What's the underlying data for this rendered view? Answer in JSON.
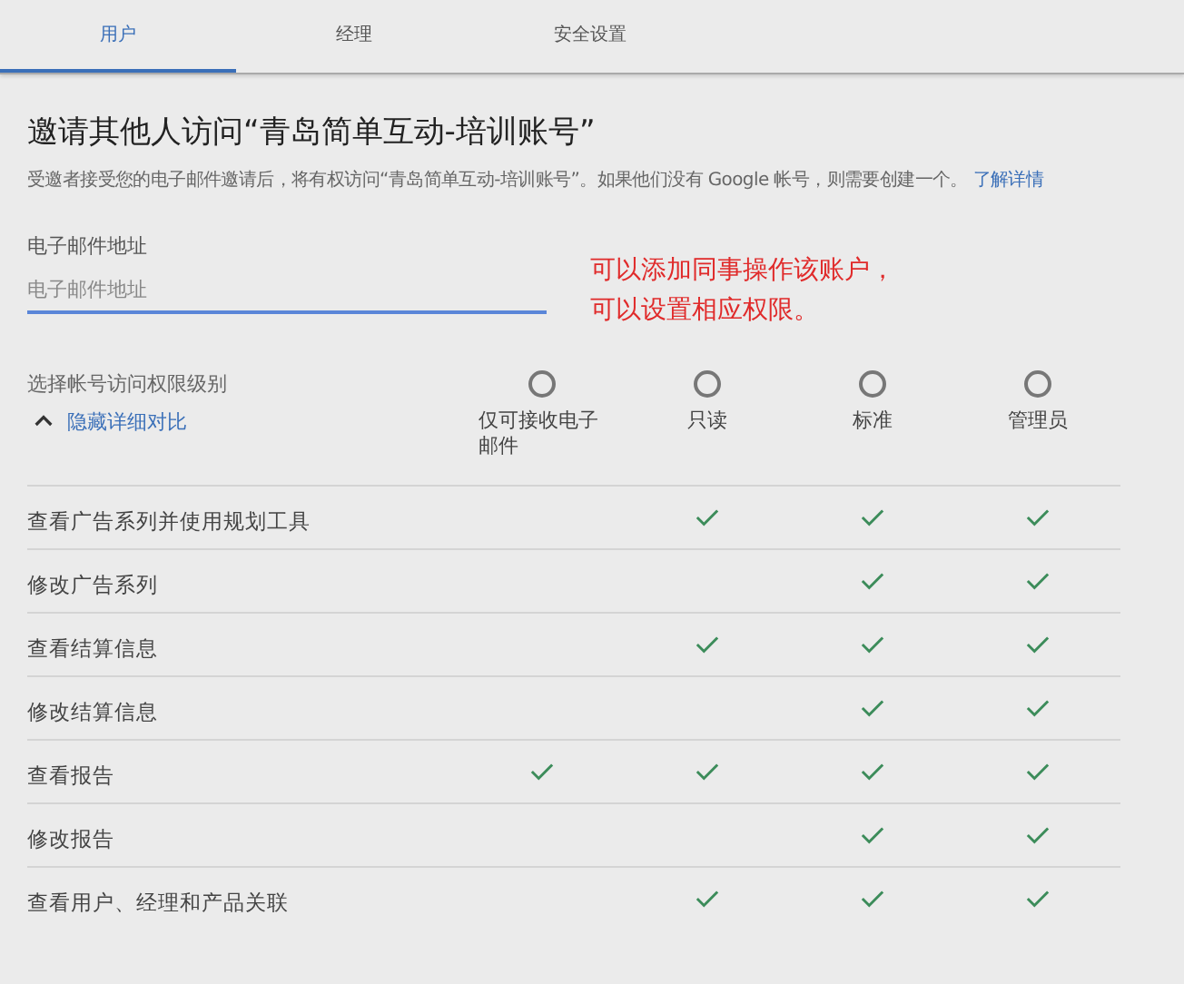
{
  "tabs": [
    {
      "label": "用户",
      "selected": true
    },
    {
      "label": "经理",
      "selected": false
    },
    {
      "label": "安全设置",
      "selected": false
    }
  ],
  "title": "邀请其他人访问“青岛简单互动-培训账号”",
  "description": "受邀者接受您的电子邮件邀请后，将有权访问“青岛简单互动-培训账号”。如果他们没有 Google 帐号，则需要创建一个。",
  "learn_more": "了解详情",
  "email": {
    "label": "电子邮件地址",
    "placeholder": "电子邮件地址"
  },
  "annotation": [
    "可以添加同事操作该账户，",
    "可以设置相应权限。"
  ],
  "access": {
    "label": "选择帐号访问权限级别",
    "toggle": "隐藏详细对比",
    "expanded": true,
    "levels": [
      {
        "label": "仅可接收电子邮件",
        "selected": false
      },
      {
        "label": "只读",
        "selected": false
      },
      {
        "label": "标准",
        "selected": false
      },
      {
        "label": "管理员",
        "selected": false
      }
    ]
  },
  "rows": [
    {
      "label": "查看广告系列并使用规划工具",
      "allowed": [
        false,
        true,
        true,
        true
      ]
    },
    {
      "label": "修改广告系列",
      "allowed": [
        false,
        false,
        true,
        true
      ]
    },
    {
      "label": "查看结算信息",
      "allowed": [
        false,
        true,
        true,
        true
      ]
    },
    {
      "label": "修改结算信息",
      "allowed": [
        false,
        false,
        true,
        true
      ]
    },
    {
      "label": "查看报告",
      "allowed": [
        true,
        true,
        true,
        true
      ]
    },
    {
      "label": "修改报告",
      "allowed": [
        false,
        false,
        true,
        true
      ]
    },
    {
      "label": "查看用户、经理和产品关联",
      "allowed": [
        false,
        true,
        true,
        true
      ]
    }
  ]
}
